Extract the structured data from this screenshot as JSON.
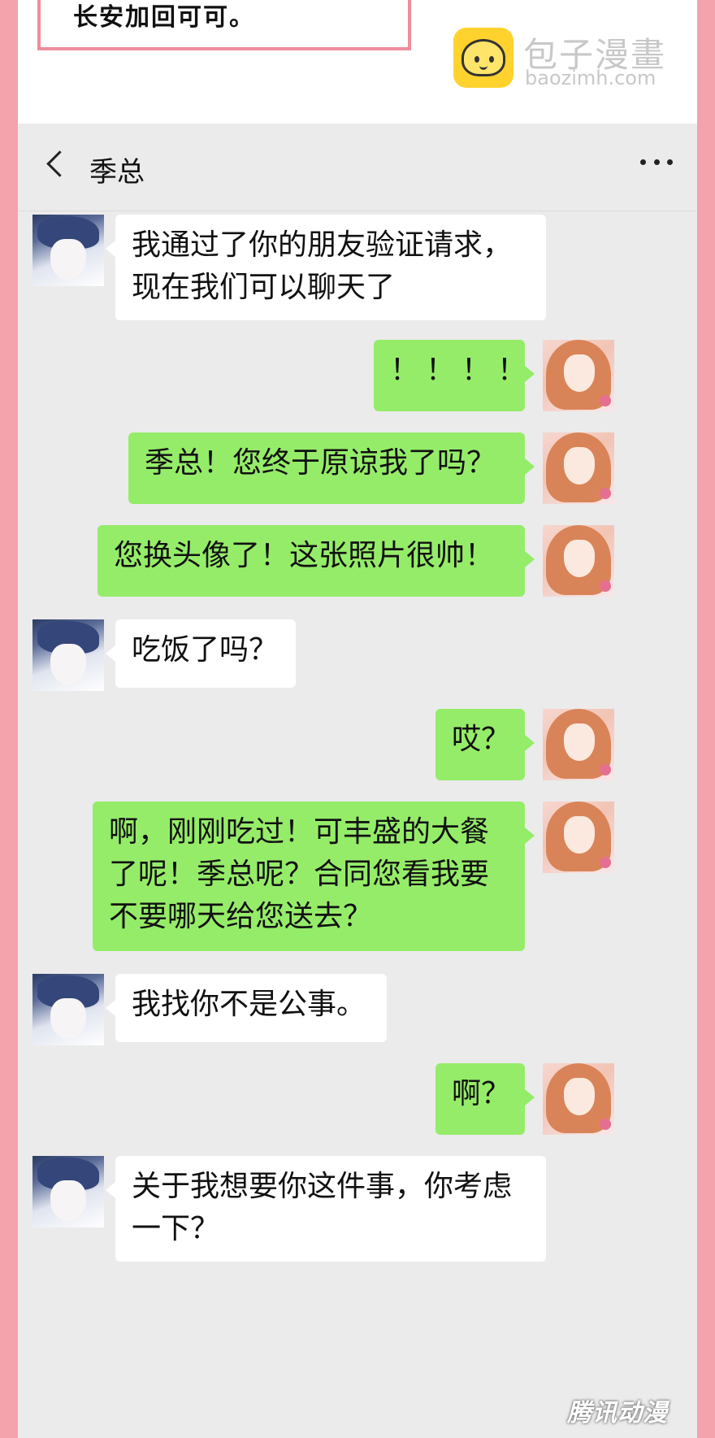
{
  "narration": {
    "text": "长安加回可可。"
  },
  "watermark": {
    "title": "包子漫畫",
    "url": "baozimh.com",
    "icon": "baozi-logo-icon"
  },
  "header": {
    "back_icon": "chevron-left-icon",
    "title": "季总",
    "more_icon": "more-dots-icon"
  },
  "messages": [
    {
      "side": "left",
      "text": "我通过了你的朋友验证请求，\n现在我们可以聊天了"
    },
    {
      "side": "right",
      "text": "！！！！"
    },
    {
      "side": "right",
      "text": "季总！您终于原谅我了吗？"
    },
    {
      "side": "right",
      "text": "您换头像了！这张照片很帅！"
    },
    {
      "side": "left",
      "text": "吃饭了吗？"
    },
    {
      "side": "right",
      "text": "哎？"
    },
    {
      "side": "right",
      "text": "啊，刚刚吃过！可丰盛的大餐\n了呢！季总呢？合同您看我要\n不要哪天给您送去？"
    },
    {
      "side": "left",
      "text": "我找你不是公事。"
    },
    {
      "side": "right",
      "text": "啊？"
    },
    {
      "side": "left",
      "text": "关于我想要你这件事，你考虑\n一下？"
    }
  ],
  "bottom_watermark": {
    "text": "腾讯动漫"
  },
  "colors": {
    "frame": "#f4a2ac",
    "chat_bg": "#ebebeb",
    "bubble_self": "#95ec69",
    "bubble_other": "#ffffff"
  }
}
